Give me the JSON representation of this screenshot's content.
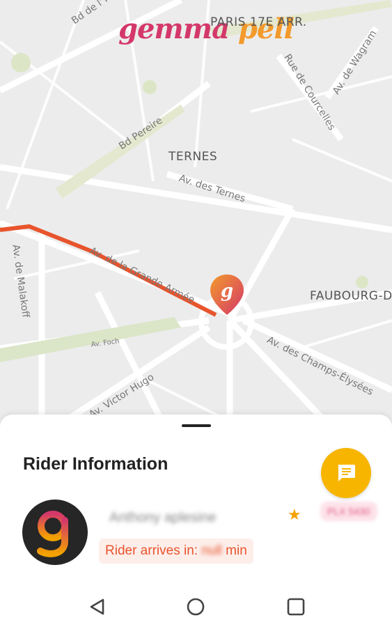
{
  "app": {
    "brand_part1": "gemma ",
    "brand_part2": "pell"
  },
  "map": {
    "district_labels": {
      "paris17": "PARIS 17E ARR.",
      "ternes": "TERNES",
      "faubourg": "FAUBOURG-D"
    },
    "streets": {
      "bd_yser": "Bd de l'Yser",
      "bd_pereire": "Bd Pereire",
      "rue_courcelles": "Rue de Courcelles",
      "av_wagram": "Av. de Wagram",
      "av_ternes": "Av. des Ternes",
      "av_grande_armee": "Av. de la Grande Armée",
      "av_malakoff": "Av. de Malakoff",
      "av_foch": "Av. Foch",
      "av_victor_hugo": "Av. Victor Hugo",
      "av_champs": "Av. des Champs-Élysées"
    },
    "route_color": "#e8542c",
    "marker_letter": "g"
  },
  "sheet": {
    "title": "Rider Information",
    "rider_name": "Anthony aplesine",
    "rating_icon": "star-icon",
    "plate": "PLX 5430",
    "eta_label": "Rider arrives in: ",
    "eta_value": "null",
    "eta_unit": " min"
  },
  "colors": {
    "accent_yellow": "#f7b500",
    "accent_orange": "#e8542c",
    "accent_pink": "#d4386a"
  }
}
